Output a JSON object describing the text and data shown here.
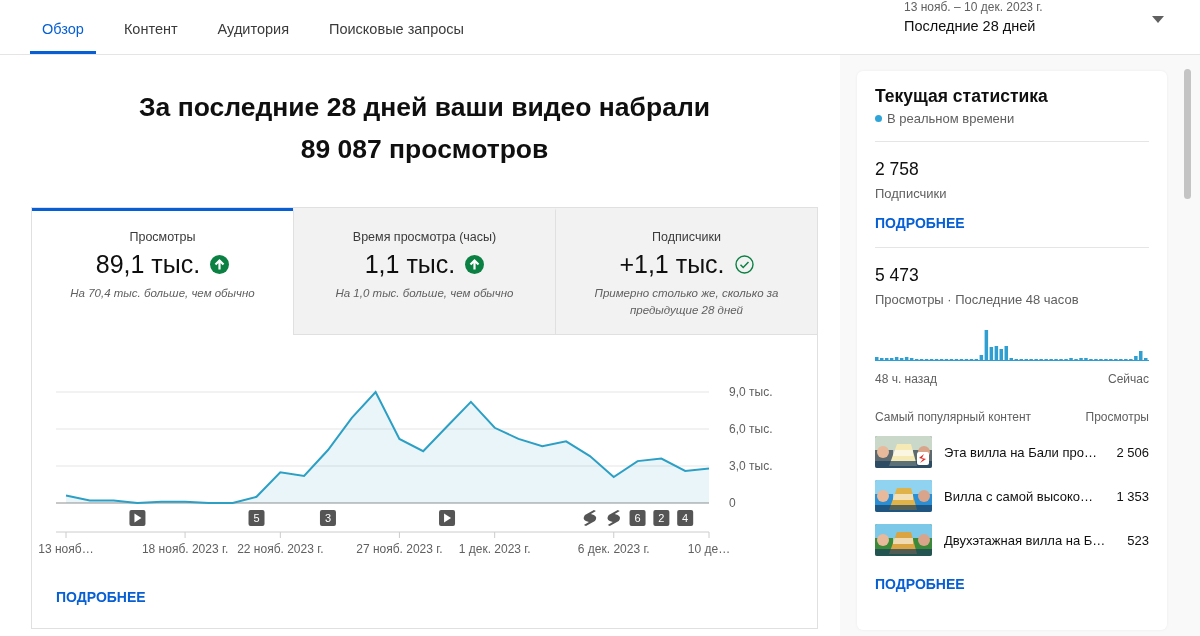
{
  "tabs": [
    {
      "label": "Обзор",
      "selected": true
    },
    {
      "label": "Контент",
      "selected": false
    },
    {
      "label": "Аудитория",
      "selected": false
    },
    {
      "label": "Поисковые запросы",
      "selected": false
    }
  ],
  "date_range": {
    "range": "13 нояб. – 10 дек. 2023 г.",
    "period": "Последние 28 дней"
  },
  "headline": [
    "За последние 28 дней ваши видео набрали",
    "89 087 просмотров"
  ],
  "metrics": [
    {
      "label": "Просмотры",
      "value": "89,1 тыс.",
      "kind": "rising",
      "note": "На 70,4 тыс. больше, чем обычно",
      "selected": true
    },
    {
      "label": "Время просмотра (часы)",
      "value": "1,1 тыс.",
      "kind": "rising",
      "note": "На 1,0 тыс. больше, чем обычно",
      "selected": false
    },
    {
      "label": "Подписчики",
      "value": "+1,1 тыс.",
      "kind": "steady",
      "note": "Примерно столько же, сколько за предыдущие 28 дней",
      "selected": false
    }
  ],
  "chart_data": {
    "type": "area",
    "categories": [
      "13 нояб…",
      null,
      null,
      null,
      null,
      "18 нояб. 2023 г.",
      null,
      null,
      null,
      "22 нояб. 2023 г.",
      null,
      null,
      null,
      null,
      "27 нояб. 2023 г.",
      null,
      null,
      null,
      "1 дек. 2023 г.",
      null,
      null,
      null,
      null,
      "6 дек. 2023 г.",
      null,
      null,
      null,
      "10 де…"
    ],
    "values": [
      0.6,
      0.2,
      0.2,
      0,
      0.1,
      0.1,
      0,
      0,
      0.5,
      2.5,
      2.2,
      4.3,
      6.9,
      9,
      5.2,
      4.2,
      6.2,
      8.2,
      6.1,
      5.2,
      4.6,
      5,
      3.8,
      2.1,
      3.4,
      3.6,
      2.6,
      2.8
    ],
    "ylim": [
      0,
      9
    ],
    "yticks": [
      {
        "value": 0,
        "label": "0"
      },
      {
        "value": 3,
        "label": "3,0 тыс."
      },
      {
        "value": 6,
        "label": "6,0 тыс."
      },
      {
        "value": 9,
        "label": "9,0 тыс."
      }
    ]
  },
  "timeline_markers": [
    {
      "kind": "none"
    },
    {
      "kind": "none"
    },
    {
      "kind": "none"
    },
    {
      "kind": "video"
    },
    {
      "kind": "none"
    },
    {
      "kind": "none"
    },
    {
      "kind": "none"
    },
    {
      "kind": "none"
    },
    {
      "kind": "count",
      "label": "5"
    },
    {
      "kind": "none"
    },
    {
      "kind": "none"
    },
    {
      "kind": "count",
      "label": "3"
    },
    {
      "kind": "none"
    },
    {
      "kind": "none"
    },
    {
      "kind": "none"
    },
    {
      "kind": "none"
    },
    {
      "kind": "video"
    },
    {
      "kind": "none"
    },
    {
      "kind": "none"
    },
    {
      "kind": "none"
    },
    {
      "kind": "none"
    },
    {
      "kind": "none"
    },
    {
      "kind": "shorts"
    },
    {
      "kind": "shorts"
    },
    {
      "kind": "count",
      "label": "6"
    },
    {
      "kind": "count",
      "label": "2"
    },
    {
      "kind": "count",
      "label": "4"
    },
    {
      "kind": "none"
    }
  ],
  "more_link": "ПОДРОБНЕЕ",
  "realtime": {
    "title": "Текущая статистика",
    "status": "В реальном времени",
    "subscribers": {
      "value": "2 758",
      "label": "Подписчики",
      "link": "ПОДРОБНЕЕ"
    },
    "views": {
      "value": "5 473",
      "label": "Просмотры · Последние 48 часов",
      "start_label": "48 ч. назад",
      "end_label": "Сейчас"
    },
    "top_content": {
      "heading": "Самый популярный контент",
      "column": "Просмотры",
      "items": [
        {
          "title": "Эта вилла на Бали про…",
          "views": "2 506",
          "kind": "picture"
        },
        {
          "title": "Вилла с самой высоко…",
          "views": "1 353",
          "kind": "picture"
        },
        {
          "title": "Двухэтажная вилла на Б…",
          "views": "523",
          "kind": "picture"
        }
      ]
    },
    "link": "ПОДРОБНЕЕ"
  }
}
